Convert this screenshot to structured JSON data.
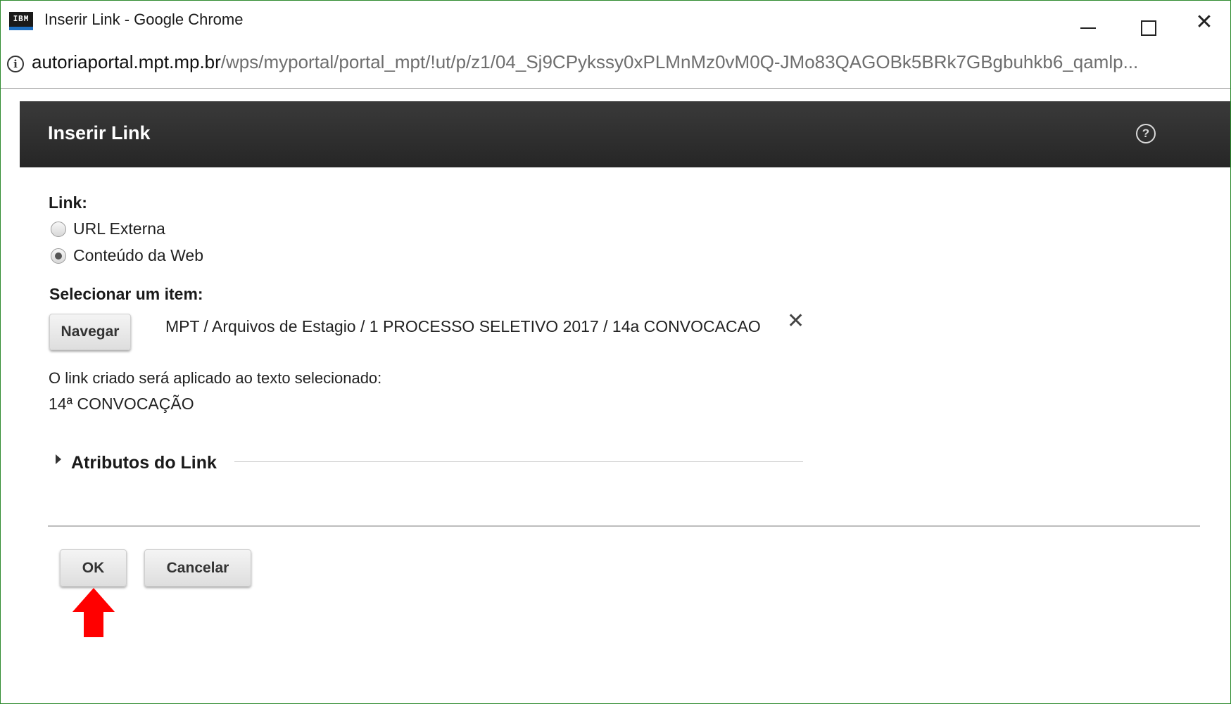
{
  "window": {
    "app_icon_text": "IBM",
    "title": "Inserir Link - Google Chrome"
  },
  "addressbar": {
    "url_host": "autoriaportal.mpt.mp.br",
    "url_path": "/wps/myportal/portal_mpt/!ut/p/z1/04_Sj9CPykssy0xPLMnMz0vM0Q-JMo83QAGOBk5BRk7GBgbuhkb6_qamlp..."
  },
  "dialog": {
    "title": "Inserir Link",
    "link_label": "Link:",
    "radio_options": [
      {
        "label": "URL Externa",
        "checked": false
      },
      {
        "label": "Conteúdo da Web",
        "checked": true
      }
    ],
    "select_item_label": "Selecionar um item:",
    "browse_button": "Navegar",
    "selected_path": "MPT / Arquivos de Estagio / 1 PROCESSO SELETIVO 2017 / 14a CONVOCACAO",
    "info_text": "O link criado será aplicado ao texto selecionado:",
    "selected_text": "14ª CONVOCAÇÃO",
    "link_attributes_label": "Atributos do Link",
    "ok_button": "OK",
    "cancel_button": "Cancelar"
  },
  "colors": {
    "window_border": "#2e8b2e",
    "header_bg": "#2e2e2e",
    "annotation_arrow": "#ff0000"
  },
  "icons": [
    "ibm-app-icon",
    "minimize-icon",
    "maximize-icon",
    "close-icon",
    "info-icon",
    "help-icon",
    "clear-icon",
    "expand-triangle-icon",
    "red-arrow-annotation"
  ]
}
